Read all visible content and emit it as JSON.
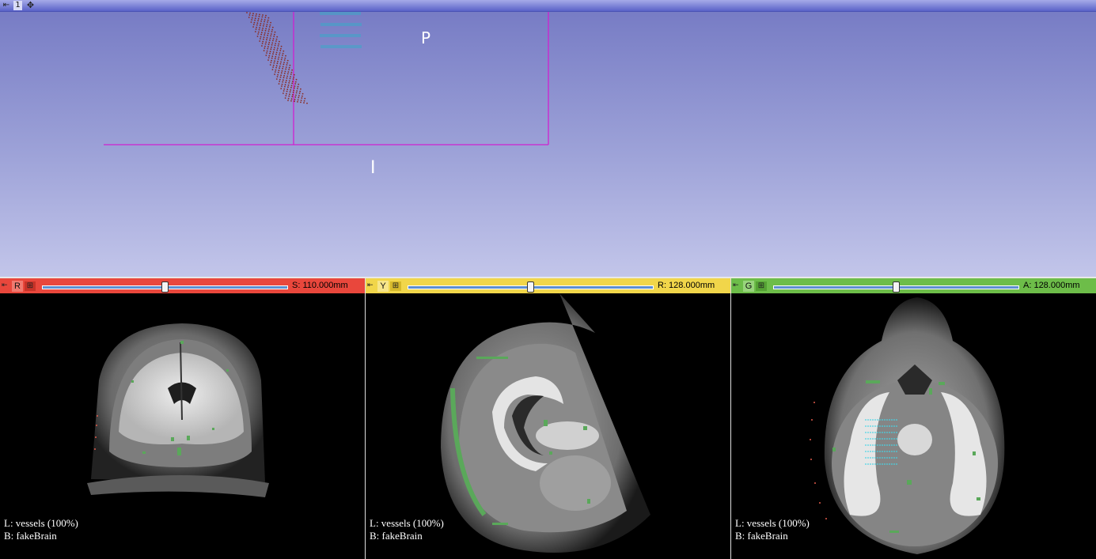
{
  "view3d": {
    "layout_number": "1",
    "orientation_top": "P",
    "orientation_bottom": "I"
  },
  "slices": [
    {
      "id": "red",
      "letter": "R",
      "color": "#e9473c",
      "offset_text": "S: 110.000mm",
      "slider_fraction": 0.5,
      "label_layer": "L: vessels (100%)",
      "background_layer": "B: fakeBrain"
    },
    {
      "id": "yellow",
      "letter": "Y",
      "color": "#f1d64a",
      "offset_text": "R: 128.000mm",
      "slider_fraction": 0.5,
      "label_layer": "L: vessels (100%)",
      "background_layer": "B: fakeBrain"
    },
    {
      "id": "green",
      "letter": "G",
      "color": "#6dbd49",
      "offset_text": "A: 128.000mm",
      "slider_fraction": 0.5,
      "label_layer": "L: vessels (100%)",
      "background_layer": "B: fakeBrain"
    }
  ],
  "icons": {
    "pin": "pin-icon",
    "link": "link-icon",
    "center": "center-view-icon"
  }
}
